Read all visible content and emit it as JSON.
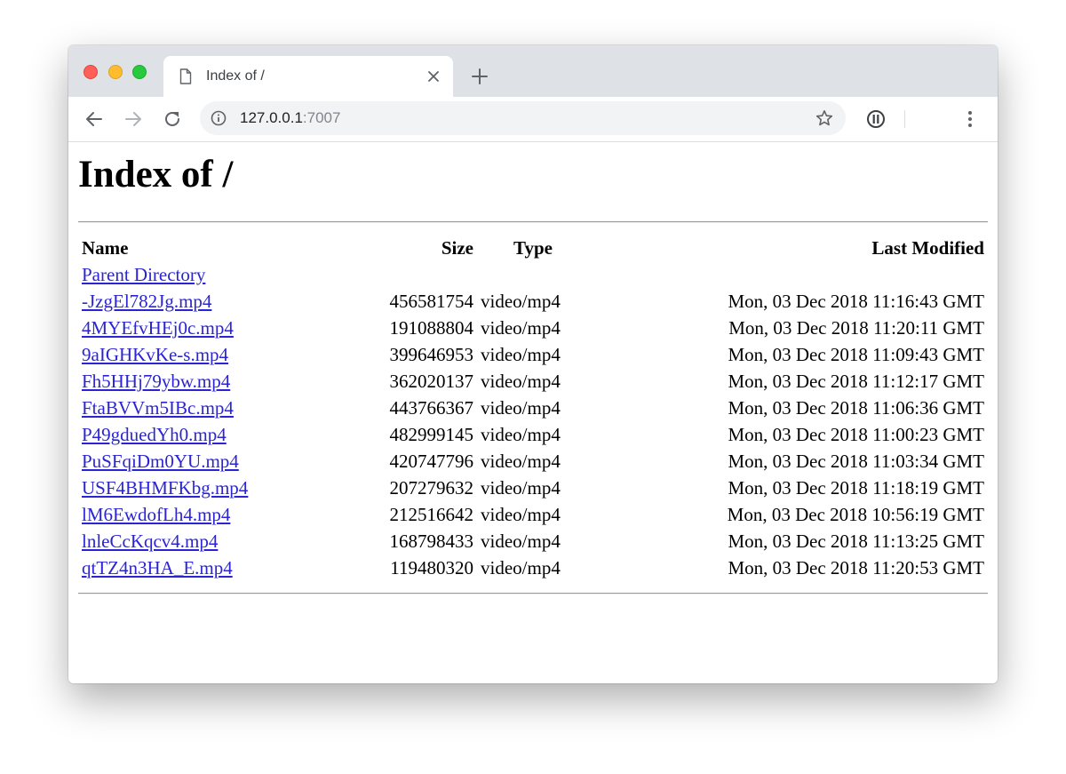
{
  "browser": {
    "tab_title": "Index of /",
    "url_host": "127.0.0.1",
    "url_port": ":7007"
  },
  "page": {
    "title": "Index of /",
    "columns": {
      "name": "Name",
      "size": "Size",
      "type": "Type",
      "modified": "Last Modified"
    },
    "parent_link": "Parent Directory",
    "files": [
      {
        "name": "-JzgEl782Jg.mp4",
        "size": "456581754",
        "type": "video/mp4",
        "modified": "Mon, 03 Dec 2018 11:16:43 GMT"
      },
      {
        "name": "4MYEfvHEj0c.mp4",
        "size": "191088804",
        "type": "video/mp4",
        "modified": "Mon, 03 Dec 2018 11:20:11 GMT"
      },
      {
        "name": "9aIGHKvKe-s.mp4",
        "size": "399646953",
        "type": "video/mp4",
        "modified": "Mon, 03 Dec 2018 11:09:43 GMT"
      },
      {
        "name": "Fh5HHj79ybw.mp4",
        "size": "362020137",
        "type": "video/mp4",
        "modified": "Mon, 03 Dec 2018 11:12:17 GMT"
      },
      {
        "name": "FtaBVVm5IBc.mp4",
        "size": "443766367",
        "type": "video/mp4",
        "modified": "Mon, 03 Dec 2018 11:06:36 GMT"
      },
      {
        "name": "P49gduedYh0.mp4",
        "size": "482999145",
        "type": "video/mp4",
        "modified": "Mon, 03 Dec 2018 11:00:23 GMT"
      },
      {
        "name": "PuSFqiDm0YU.mp4",
        "size": "420747796",
        "type": "video/mp4",
        "modified": "Mon, 03 Dec 2018 11:03:34 GMT"
      },
      {
        "name": "USF4BHMFKbg.mp4",
        "size": "207279632",
        "type": "video/mp4",
        "modified": "Mon, 03 Dec 2018 11:18:19 GMT"
      },
      {
        "name": "lM6EwdofLh4.mp4",
        "size": "212516642",
        "type": "video/mp4",
        "modified": "Mon, 03 Dec 2018 10:56:19 GMT"
      },
      {
        "name": "lnleCcKqcv4.mp4",
        "size": "168798433",
        "type": "video/mp4",
        "modified": "Mon, 03 Dec 2018 11:13:25 GMT"
      },
      {
        "name": "qtTZ4n3HA_E.mp4",
        "size": "119480320",
        "type": "video/mp4",
        "modified": "Mon, 03 Dec 2018 11:20:53 GMT"
      }
    ]
  },
  "icons": {
    "tab": "document-icon",
    "close": "close-icon",
    "new_tab": "plus-icon",
    "back": "back-arrow-icon",
    "forward": "forward-arrow-icon",
    "reload": "reload-icon",
    "site_info": "info-icon",
    "bookmark": "star-icon",
    "extension": "extension-icon",
    "menu": "kebab-menu-icon"
  },
  "colors": {
    "tabstrip": "#dee1e6",
    "omnibox": "#f1f3f4",
    "link": "#2a24d4",
    "traffic_red": "#fe5f57",
    "traffic_yellow": "#febc2e",
    "traffic_green": "#28c840"
  }
}
